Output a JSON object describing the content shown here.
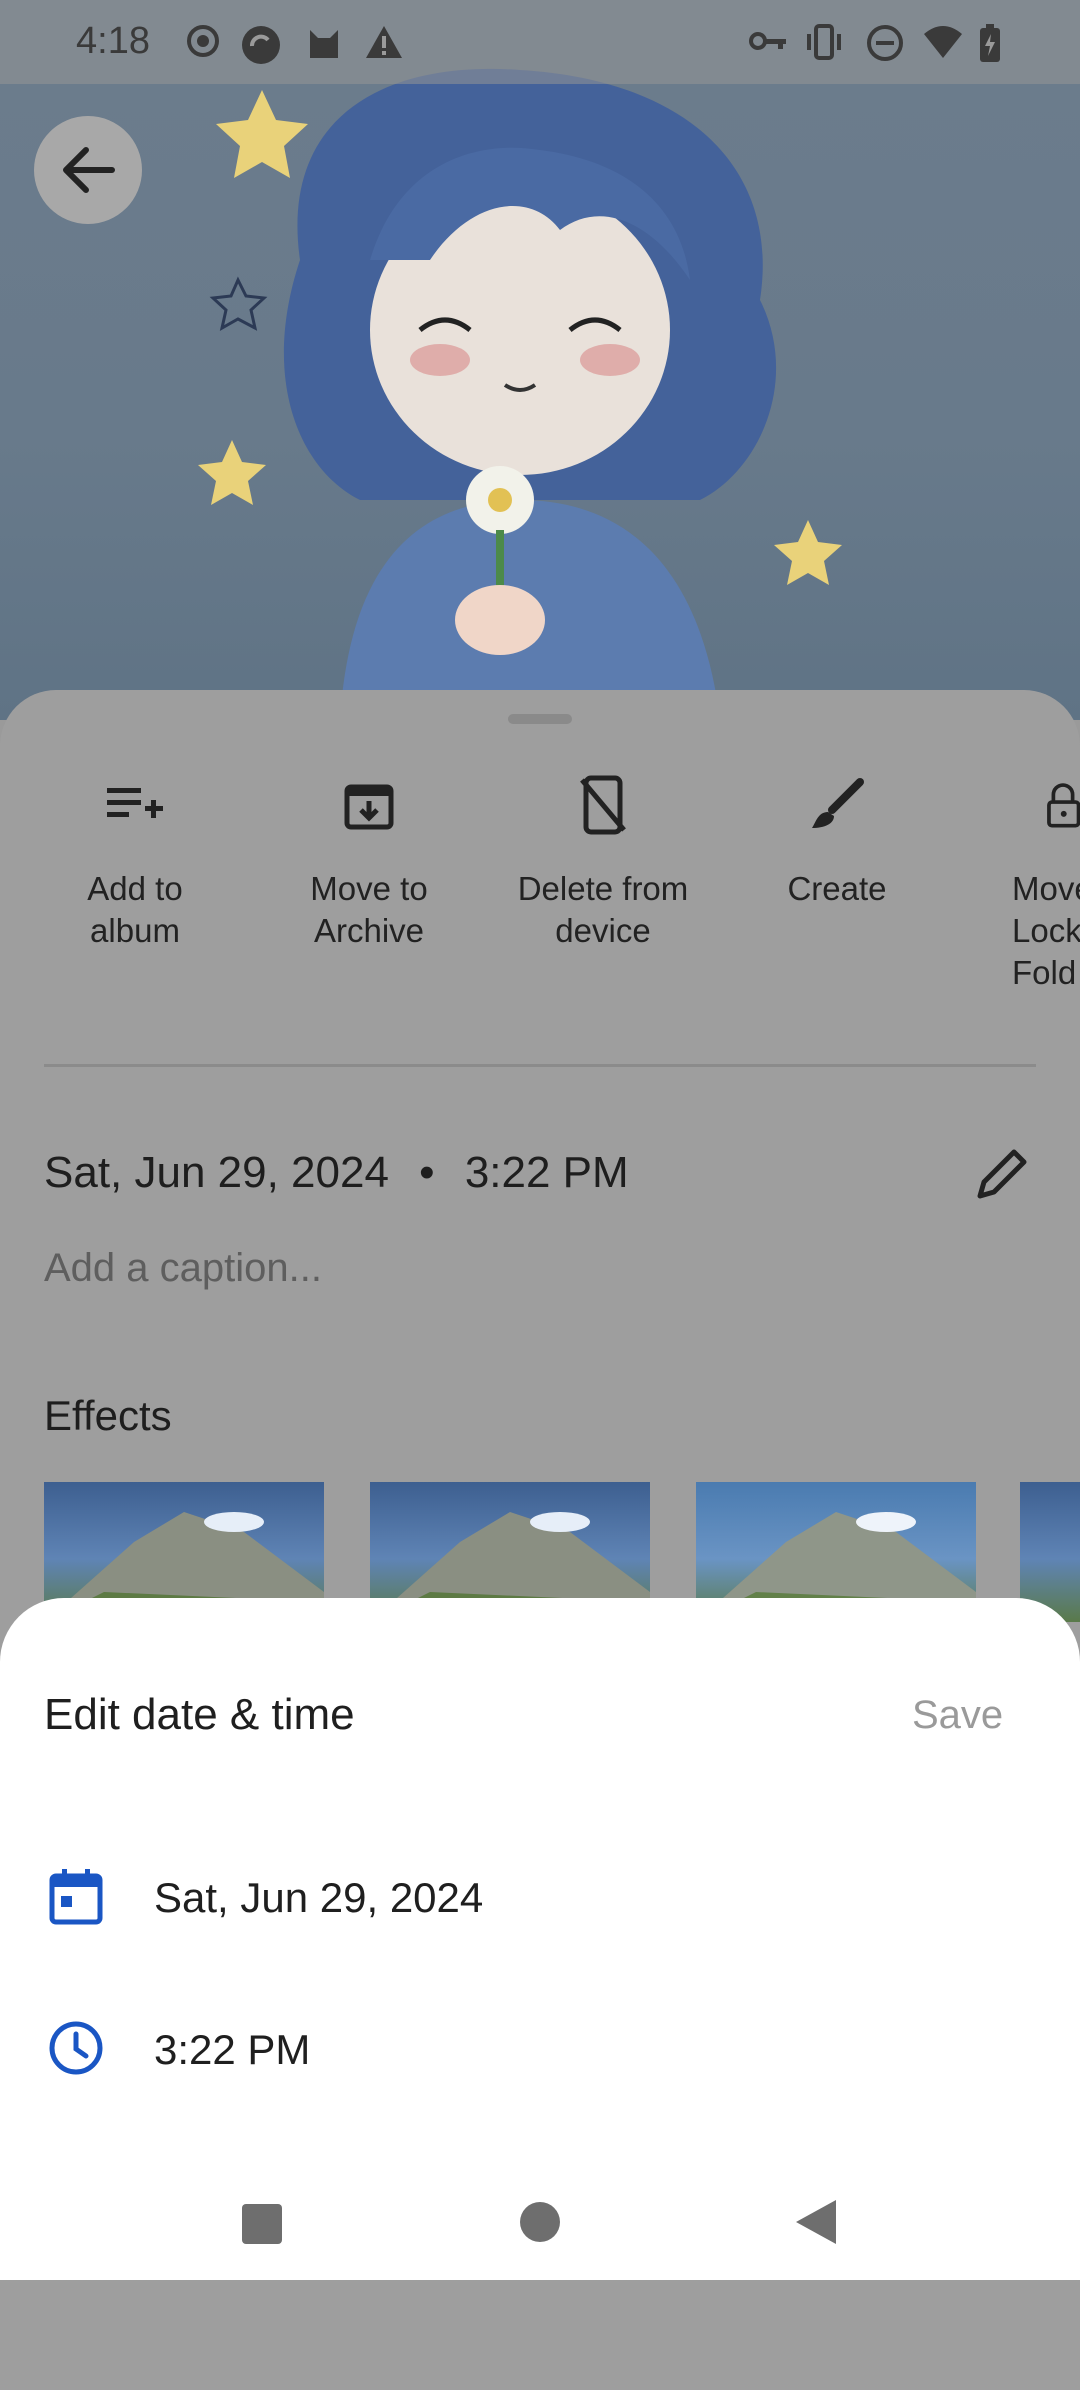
{
  "status_bar": {
    "time": "4:18",
    "left_icons": [
      "record-icon",
      "sync-icon",
      "cat-icon",
      "warning-icon"
    ],
    "right_icons": [
      "vpn-key-icon",
      "vibrate-icon",
      "do-not-disturb-icon",
      "wifi-icon",
      "battery-charging-icon"
    ]
  },
  "photo": {
    "description_icon": "anime-girl-with-flower-image"
  },
  "actions": [
    {
      "label": "Add to\nalbum",
      "icon": "playlist-add-icon"
    },
    {
      "label": "Move to\nArchive",
      "icon": "archive-icon"
    },
    {
      "label": "Delete from\ndevice",
      "icon": "phone-delete-icon"
    },
    {
      "label": "Create",
      "icon": "brush-icon"
    },
    {
      "label": "Move\nLock\nFold",
      "icon": "lock-icon"
    }
  ],
  "details": {
    "date": "Sat, Jun 29, 2024",
    "separator": "•",
    "time": "3:22 PM",
    "caption_placeholder": "Add a caption..."
  },
  "effects": {
    "title": "Effects"
  },
  "edit_sheet": {
    "title": "Edit date & time",
    "save_label": "Save",
    "date_value": "Sat, Jun 29, 2024",
    "time_value": "3:22 PM"
  },
  "colors": {
    "accent": "#1a56c4",
    "scrim": "#9e9e9e"
  }
}
